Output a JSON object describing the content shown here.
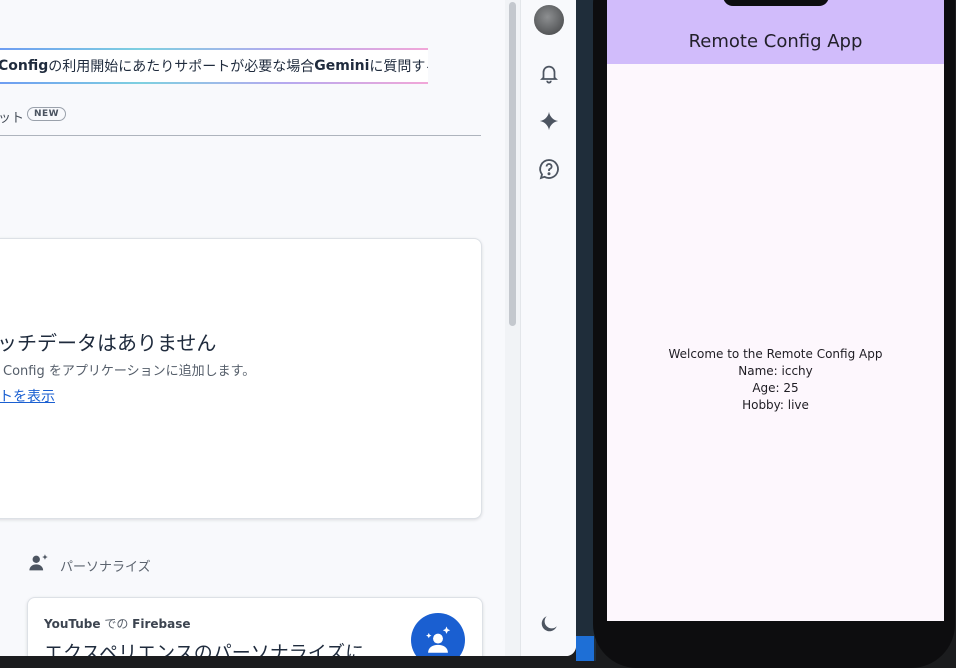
{
  "console": {
    "gemini_banner": {
      "product": "Config",
      "text_mid": " の利用開始にあたりサポートが必要な場合",
      "gemini": "Gemini",
      "text_end": " に質問する"
    },
    "tab": {
      "label": "ット",
      "badge": "NEW"
    },
    "empty_state": {
      "title": "ッチデータはありません",
      "description": "Config をアプリケーションに追加します。",
      "link": "トを表示"
    },
    "personalize": {
      "label": "パーソナライズ"
    },
    "youtube_card": {
      "source_prefix": "YouTube",
      "source_mid": " での ",
      "source_brand": "Firebase",
      "title": "エクスペリエンスのパーソナライズに"
    }
  },
  "rail": {
    "icons": [
      "avatar",
      "bell-icon",
      "spark-icon",
      "help-icon",
      "moon-icon"
    ]
  },
  "phone_app": {
    "title": "Remote Config App",
    "welcome": "Welcome to the Remote Config App",
    "name_line": "Name: icchy",
    "age_line": "Age: 25",
    "hobby_line": "Hobby: live"
  },
  "colors": {
    "app_bar": "#d1bcfb",
    "app_background": "#fdf7fd",
    "link": "#1a5fd1",
    "console_background": "#f8f9fc"
  }
}
